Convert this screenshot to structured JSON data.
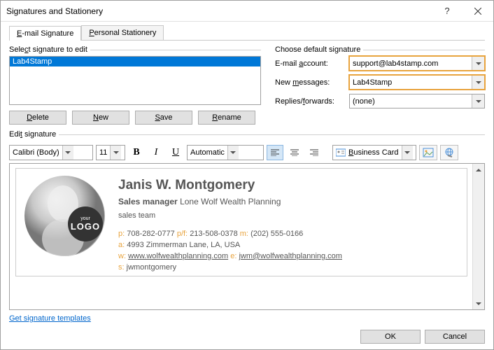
{
  "window": {
    "title": "Signatures and Stationery"
  },
  "tabs": {
    "email": "E-mail Signature",
    "personal": "Personal Stationery"
  },
  "select_group": {
    "label": "Select signature to edit",
    "items": [
      "Lab4Stamp"
    ],
    "buttons": {
      "delete": "Delete",
      "new": "New",
      "save": "Save",
      "rename": "Rename"
    }
  },
  "defaults": {
    "label": "Choose default signature",
    "email_label": "E-mail account:",
    "email_value": "support@lab4stamp.com",
    "newmsg_label": "New messages:",
    "newmsg_value": "Lab4Stamp",
    "replies_label": "Replies/forwards:",
    "replies_value": "(none)"
  },
  "edit_label": "Edit signature",
  "toolbar": {
    "font": "Calibri (Body)",
    "size": "11",
    "color": "Automatic",
    "bizcard": "Business Card"
  },
  "signature": {
    "logo_small": "your",
    "logo_big": "LOGO",
    "name": "Janis W. Montgomery",
    "role_bold": "Sales manager",
    "role_company": "Lone Wolf Wealth Planning",
    "team": "sales team",
    "phone1": "708-282-0777",
    "phone2": "213-508-0378",
    "phone3": "(202) 555-0166",
    "address": "4993 Zimmerman Lane, LA, USA",
    "web": "www.wolfwealthplanning.com",
    "email": "jwm@wolfwealthplanning.com",
    "skype": "jwmontgomery"
  },
  "link": "Get signature templates",
  "footer": {
    "ok": "OK",
    "cancel": "Cancel"
  }
}
